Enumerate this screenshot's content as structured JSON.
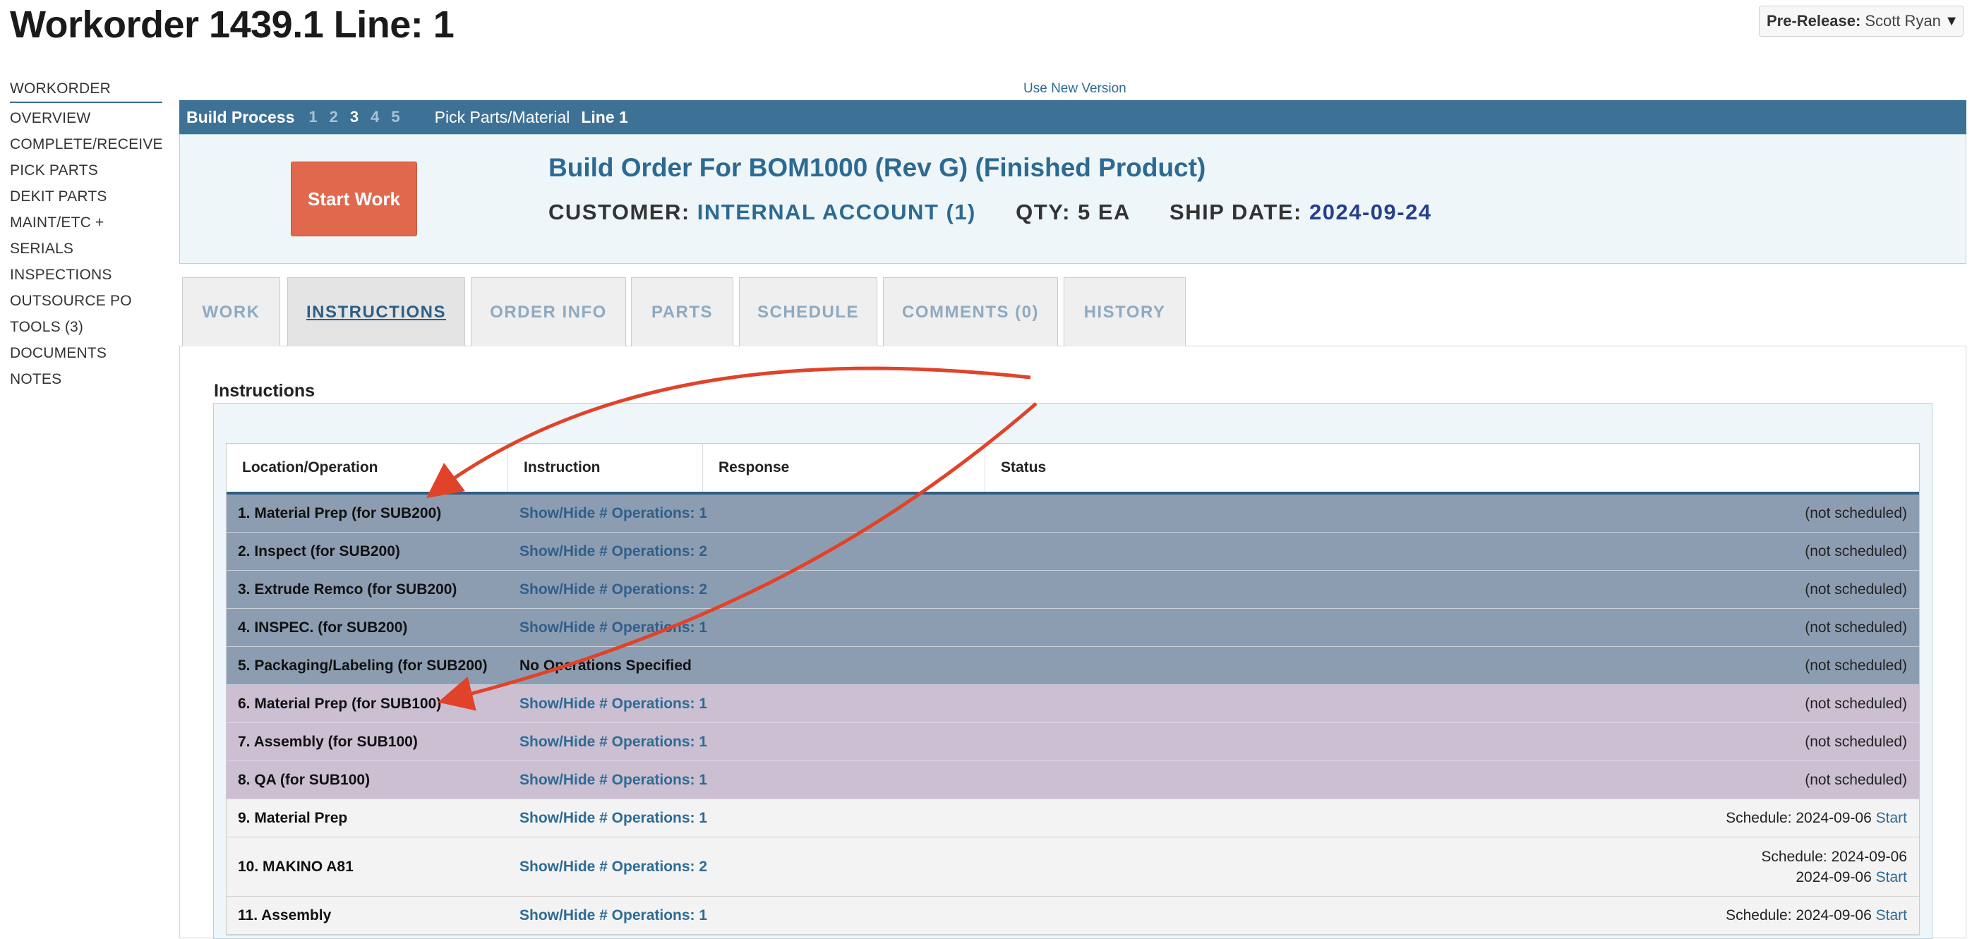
{
  "page_title": "Workorder 1439.1 Line: 1",
  "prerelease": {
    "label": "Pre-Release:",
    "user": "Scott Ryan"
  },
  "use_new_version": "Use New Version",
  "left_nav": [
    "WORKORDER",
    "OVERVIEW",
    "COMPLETE/RECEIVE",
    "PICK PARTS",
    "DEKIT PARTS",
    "MAINT/ETC +",
    "SERIALS",
    "INSPECTIONS",
    "OUTSOURCE PO",
    "TOOLS (3)",
    "DOCUMENTS",
    "NOTES"
  ],
  "build_bar": {
    "label": "Build Process",
    "steps": [
      "1",
      "2",
      "3",
      "4",
      "5"
    ],
    "current_step": "3",
    "step_name": "Pick Parts/Material",
    "line": "Line 1"
  },
  "header": {
    "start_button": "Start Work",
    "title": "Build Order For BOM1000 (Rev G) (Finished Product)",
    "customer_label": "CUSTOMER:",
    "customer_value": "INTERNAL ACCOUNT (1)",
    "qty": "QTY: 5 EA",
    "ship_label": "SHIP DATE:",
    "ship_value": "2024-09-24"
  },
  "tabs": [
    "WORK",
    "INSTRUCTIONS",
    "ORDER INFO",
    "PARTS",
    "SCHEDULE",
    "COMMENTS (0)",
    "HISTORY"
  ],
  "active_tab": "INSTRUCTIONS",
  "instructions": {
    "heading": "Instructions",
    "columns": [
      "Location/Operation",
      "Instruction",
      "Response",
      "Status"
    ],
    "rows": [
      {
        "loc": "1. Material Prep (for SUB200)",
        "ins": "Show/Hide # Operations: 1",
        "status": "(not scheduled)"
      },
      {
        "loc": "2. Inspect (for SUB200)",
        "ins": "Show/Hide # Operations: 2",
        "status": "(not scheduled)"
      },
      {
        "loc": "3. Extrude Remco (for SUB200)",
        "ins": "Show/Hide # Operations: 2",
        "status": "(not scheduled)"
      },
      {
        "loc": "4. INSPEC. (for SUB200)",
        "ins": "Show/Hide # Operations: 1",
        "status": "(not scheduled)"
      },
      {
        "loc": "5. Packaging/Labeling (for SUB200)",
        "ins": "No Operations Specified",
        "status": "(not scheduled)"
      },
      {
        "loc": "6. Material Prep (for SUB100)",
        "ins": "Show/Hide # Operations: 1",
        "status": "(not scheduled)"
      },
      {
        "loc": "7. Assembly (for SUB100)",
        "ins": "Show/Hide # Operations: 1",
        "status": "(not scheduled)"
      },
      {
        "loc": "8. QA (for SUB100)",
        "ins": "Show/Hide # Operations: 1",
        "status": "(not scheduled)"
      },
      {
        "loc": "9. Material Prep",
        "ins": "Show/Hide # Operations: 1",
        "status": "Schedule: 2024-09-06",
        "start": "Start"
      },
      {
        "loc": "10. MAKINO A81",
        "ins": "Show/Hide # Operations: 2",
        "status": "Schedule: 2024-09-06",
        "status2": "2024-09-06",
        "start": "Start"
      },
      {
        "loc": "11. Assembly",
        "ins": "Show/Hide # Operations: 1",
        "status": "Schedule: 2024-09-06",
        "start": "Start"
      }
    ]
  },
  "colors": {
    "build_bar": "#3e7196",
    "start_button": "#e0694d",
    "grey_row": "#8d9db1",
    "purple_row": "#cbbfd1",
    "annotation_arrow": "#e0432a"
  }
}
